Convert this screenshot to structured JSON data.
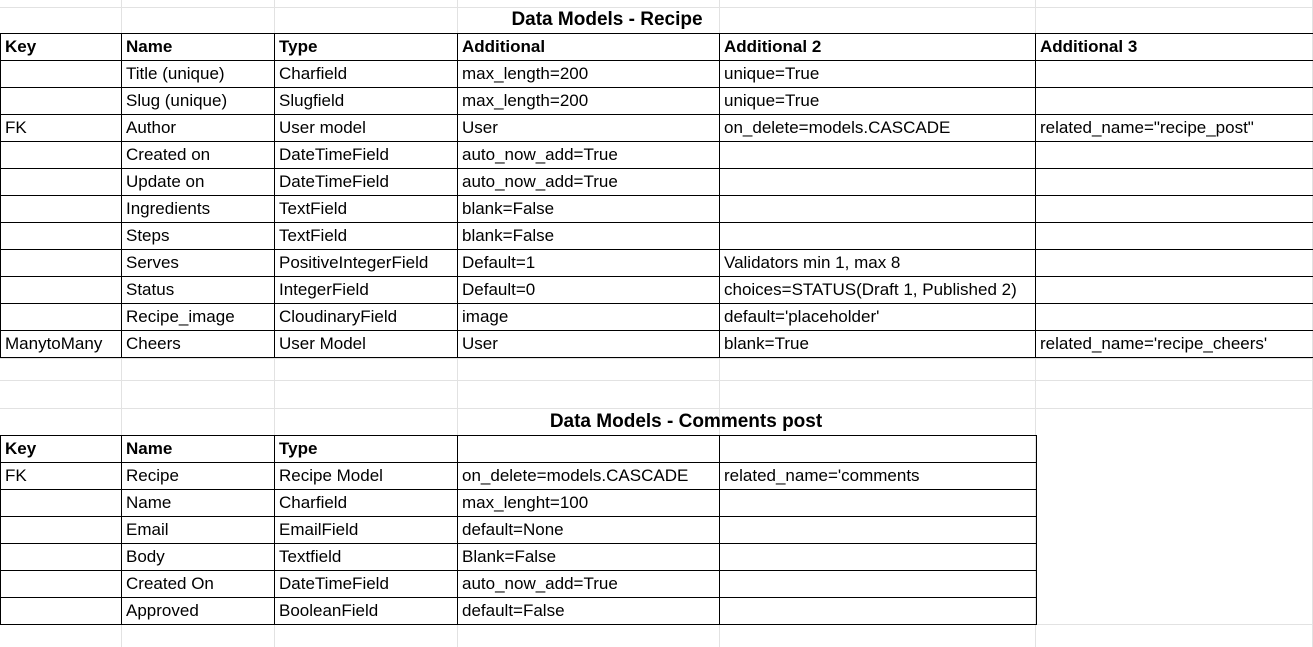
{
  "recipe": {
    "title": "Data Models - Recipe",
    "headers": [
      "Key",
      "Name",
      "Type",
      "Additional",
      "Additional 2",
      "Additional 3"
    ],
    "rows": [
      [
        "",
        "Title (unique)",
        "Charfield",
        "max_length=200",
        "unique=True",
        ""
      ],
      [
        "",
        "Slug (unique)",
        "Slugfield",
        "max_length=200",
        "unique=True",
        ""
      ],
      [
        "FK",
        "Author",
        "User model",
        "User",
        "on_delete=models.CASCADE",
        "related_name=\"recipe_post\""
      ],
      [
        "",
        "Created on",
        "DateTimeField",
        "auto_now_add=True",
        "",
        ""
      ],
      [
        "",
        "Update on",
        "DateTimeField",
        "auto_now_add=True",
        "",
        ""
      ],
      [
        "",
        "Ingredients",
        "TextField",
        "blank=False",
        "",
        ""
      ],
      [
        "",
        "Steps",
        "TextField",
        "blank=False",
        "",
        ""
      ],
      [
        "",
        "Serves",
        "PositiveIntegerField",
        "Default=1",
        "Validators min 1, max 8",
        ""
      ],
      [
        "",
        "Status",
        "IntegerField",
        "Default=0",
        "choices=STATUS(Draft 1, Published 2)",
        ""
      ],
      [
        "",
        "Recipe_image",
        "CloudinaryField",
        "image",
        "default='placeholder'",
        ""
      ],
      [
        "ManytoMany",
        "Cheers",
        "User Model",
        "User",
        "blank=True",
        "related_name='recipe_cheers'"
      ]
    ]
  },
  "comments": {
    "title": "Data Models - Comments post",
    "headers": [
      "Key",
      "Name",
      "Type",
      "",
      ""
    ],
    "rows": [
      [
        "FK",
        "Recipe",
        "Recipe Model",
        " on_delete=models.CASCADE",
        "related_name='comments"
      ],
      [
        "",
        "Name",
        "Charfield",
        "max_lenght=100",
        ""
      ],
      [
        "",
        "Email",
        "EmailField",
        "default=None",
        ""
      ],
      [
        "",
        "Body",
        "Textfield",
        "Blank=False",
        ""
      ],
      [
        "",
        "Created On",
        "DateTimeField",
        "auto_now_add=True",
        ""
      ],
      [
        "",
        "Approved",
        "BooleanField",
        "default=False",
        ""
      ]
    ]
  }
}
